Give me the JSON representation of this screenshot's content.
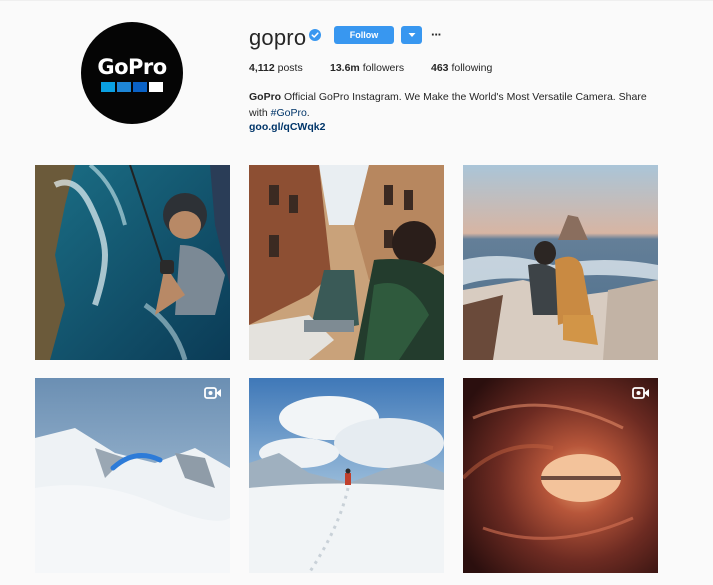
{
  "profile": {
    "username": "gopro",
    "follow_label": "Follow",
    "more_label": "···",
    "avatar_logo_text": "GoPro"
  },
  "stats": {
    "posts_count": "4,112",
    "posts_label": "posts",
    "followers_count": "13.6m",
    "followers_label": "followers",
    "following_count": "463",
    "following_label": "following"
  },
  "bio": {
    "name": "GoPro",
    "text": "Official GoPro Instagram. We Make the World's Most Versatile Camera. Share with",
    "hashtag": "#GoPro",
    "end": ".",
    "link": "goo.gl/qCWqk2"
  },
  "posts": [
    {
      "subject": "paragliding selfie over coastline",
      "is_video": false
    },
    {
      "subject": "venice canal",
      "is_video": false
    },
    {
      "subject": "person hugging dog by sea",
      "is_video": false
    },
    {
      "subject": "paraglider over snowy mountains",
      "is_video": true
    },
    {
      "subject": "hiker in snow",
      "is_video": false
    },
    {
      "subject": "inside a wave tube",
      "is_video": true
    }
  ],
  "colors": {
    "accent": "#3897f0",
    "link": "#003569",
    "background": "#fafafa",
    "logo_blue_1": "#0aa0e2",
    "logo_blue_2": "#0a7ad1"
  },
  "icons": {
    "verified": "verified-badge-icon",
    "dropdown": "chevron-down-icon",
    "video": "video-camera-icon"
  }
}
